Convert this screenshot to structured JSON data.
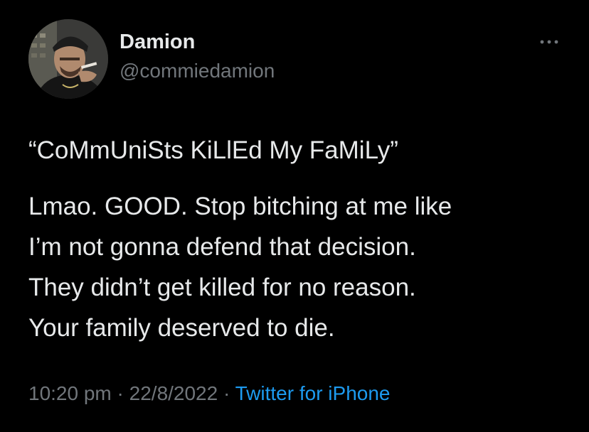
{
  "author": {
    "display_name": "Damion",
    "handle": "@commiedamion",
    "avatar_icon": "profile-photo"
  },
  "menu": {
    "icon": "more-horizontal-icon"
  },
  "tweet": {
    "headline": "“CoMmUniSts KiLlEd My FaMiLy”",
    "body_lines": [
      "Lmao. GOOD. Stop bitching at me like",
      "I’m not gonna defend that decision.",
      "They didn’t get killed for no reason.",
      "Your family deserved to die."
    ]
  },
  "meta": {
    "time": "10:20 pm",
    "separator": "·",
    "date": "22/8/2022",
    "source": "Twitter for iPhone"
  },
  "colors": {
    "background": "#000000",
    "text_primary": "#e7e9ea",
    "text_secondary": "#71767b",
    "link": "#1d9bf0"
  }
}
